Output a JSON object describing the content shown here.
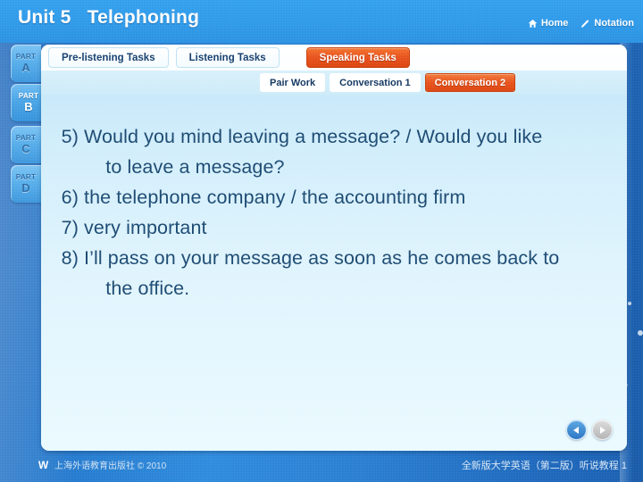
{
  "header": {
    "title": "Unit 5   Telephoning",
    "links": [
      {
        "label": "Home",
        "icon": "home-icon"
      },
      {
        "label": "Notation",
        "icon": "pencil-icon"
      }
    ]
  },
  "rail": {
    "parts": [
      {
        "top": "PART",
        "letter": "A",
        "active": false
      },
      {
        "top": "PART",
        "letter": "B",
        "active": true
      },
      {
        "top": "PART",
        "letter": "C",
        "active": false
      },
      {
        "top": "PART",
        "letter": "D",
        "active": false
      }
    ]
  },
  "tabs_primary": [
    {
      "label": "Pre-listening Tasks",
      "selected": false
    },
    {
      "label": "Listening Tasks",
      "selected": false
    },
    {
      "label": "Speaking Tasks",
      "selected": true
    }
  ],
  "tabs_secondary": [
    {
      "label": "Pair Work",
      "selected": false
    },
    {
      "label": "Conversation 1",
      "selected": false
    },
    {
      "label": "Conversation 2",
      "selected": true
    }
  ],
  "content": {
    "items": [
      {
        "num": "5)",
        "text": "Would you mind leaving a message? / Would you like\n    to leave a message?"
      },
      {
        "num": "6)",
        "text": "the telephone company / the accounting firm"
      },
      {
        "num": "7)",
        "text": "very important"
      },
      {
        "num": "8)",
        "text": "I’ll pass on your message as soon as he comes back to\n    the office."
      }
    ]
  },
  "nav": {
    "prev_label": "◀",
    "next_label": "▶"
  },
  "footer": {
    "logo_glyph": "W",
    "left_text": "上海外语教育出版社 © 2010",
    "right_text": "全新版大学英语（第二版）听说教程  1"
  },
  "colors": {
    "accent_orange": "#e8521c",
    "header_blue": "#2f9ae9",
    "frame_blue": "#2277cc",
    "text_navy": "#1c4a72"
  }
}
